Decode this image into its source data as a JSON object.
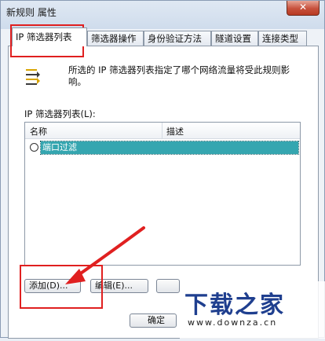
{
  "window": {
    "title": "新规则 属性",
    "close_glyph": "✕"
  },
  "tabs": [
    {
      "label": "IP 筛选器列表",
      "active": true
    },
    {
      "label": "筛选器操作",
      "active": false
    },
    {
      "label": "身份验证方法",
      "active": false
    },
    {
      "label": "隧道设置",
      "active": false
    },
    {
      "label": "连接类型",
      "active": false
    }
  ],
  "panel": {
    "icon": "filter-list-icon",
    "description": "所选的 IP 筛选器列表指定了哪个网络流量将受此规则影响。",
    "list_label": "IP 筛选器列表(L):",
    "columns": [
      "名称",
      "描述"
    ],
    "rows": [
      {
        "name": "端口过滤",
        "description": "",
        "selected": true
      }
    ]
  },
  "buttons": {
    "add": "添加(D)...",
    "edit": "编辑(E)...",
    "ok": "确定"
  },
  "watermark": {
    "brand": "下载之家",
    "url": "www.downza.cn"
  },
  "colors": {
    "selection": "#35a6b0",
    "annotation": "#e02020",
    "watermark": "#1f3f8f"
  }
}
